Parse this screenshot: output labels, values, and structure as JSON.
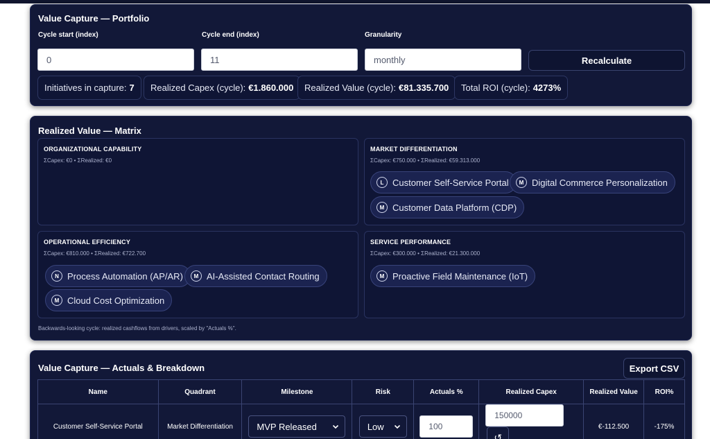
{
  "portfolio": {
    "title": "Value Capture — Portfolio",
    "cycle_start": {
      "label": "Cycle start (index)",
      "value": "0"
    },
    "cycle_end": {
      "label": "Cycle end (index)",
      "value": "11"
    },
    "granularity": {
      "label": "Granularity",
      "value": "monthly"
    },
    "recalculate_label": "Recalculate",
    "stats": [
      {
        "label": "Initiatives in capture:",
        "value": "7"
      },
      {
        "label": "Realized Capex (cycle):",
        "value": "€1.860.000"
      },
      {
        "label": "Realized Value (cycle):",
        "value": "€81.335.700"
      },
      {
        "label": "Total ROI (cycle):",
        "value": "4273%"
      }
    ]
  },
  "matrix": {
    "title": "Realized Value — Matrix",
    "quadrants": [
      {
        "title": "ORGANIZATIONAL CAPABILITY",
        "sums": "ΣCapex: €0 • ΣRealized: €0",
        "chips": []
      },
      {
        "title": "MARKET DIFFERENTIATION",
        "sums": "ΣCapex: €750.000 • ΣRealized: €59.313.000",
        "chips": [
          {
            "badge": "L",
            "label": "Customer Self-Service Portal"
          },
          {
            "badge": "M",
            "label": "Digital Commerce Personalization"
          },
          {
            "badge": "M",
            "label": "Customer Data Platform (CDP)"
          }
        ]
      },
      {
        "title": "OPERATIONAL EFFICIENCY",
        "sums": "ΣCapex: €810.000 • ΣRealized: €722.700",
        "chips": [
          {
            "badge": "N",
            "label": "Process Automation (AP/AR)"
          },
          {
            "badge": "M",
            "label": "AI-Assisted Contact Routing"
          },
          {
            "badge": "M",
            "label": "Cloud Cost Optimization"
          }
        ]
      },
      {
        "title": "SERVICE PERFORMANCE",
        "sums": "ΣCapex: €300.000 • ΣRealized: €21.300.000",
        "chips": [
          {
            "badge": "M",
            "label": "Proactive Field Maintenance (IoT)"
          }
        ]
      }
    ],
    "note": "Backwards-looking cycle: realized cashflows from drivers, scaled by \"Actuals %\"."
  },
  "breakdown": {
    "title": "Value Capture — Actuals & Breakdown",
    "export_label": "Export CSV",
    "columns": [
      "Name",
      "Quadrant",
      "Milestone",
      "Risk",
      "Actuals %",
      "Realized Capex",
      "Realized Value",
      "ROI%"
    ],
    "rows": [
      {
        "name": "Customer Self-Service Portal",
        "quadrant": "Market Differentiation",
        "milestone": "MVP Released",
        "risk": "Low",
        "actuals": "100",
        "capex": "150000",
        "value": "€-112.500",
        "roi": "-175%"
      }
    ]
  }
}
